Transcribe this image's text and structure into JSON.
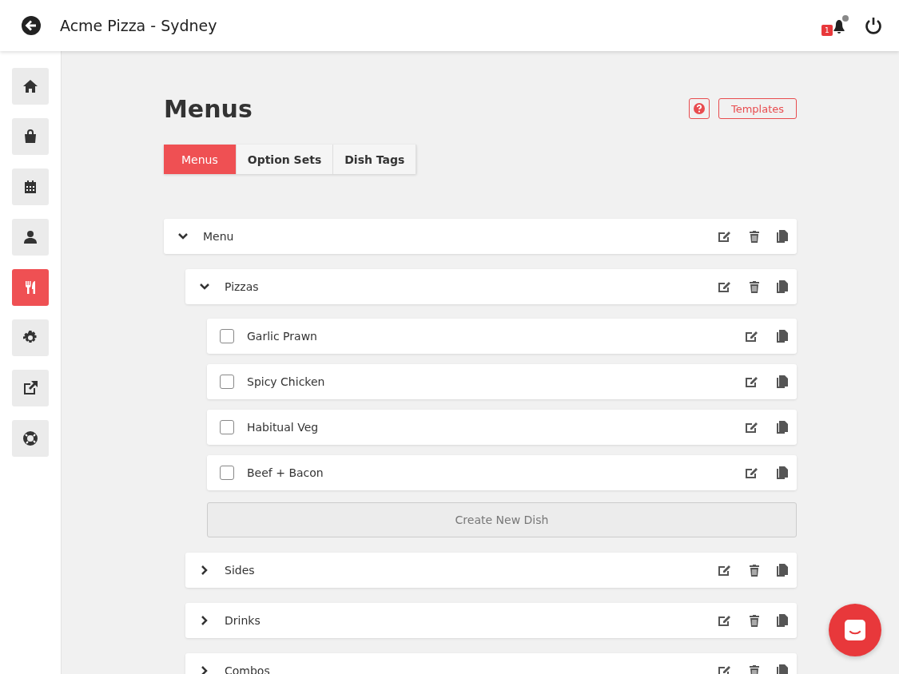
{
  "header": {
    "title": "Acme Pizza - Sydney",
    "notification_count": "1"
  },
  "sidebar": {
    "items": [
      {
        "selected": false
      },
      {
        "selected": false
      },
      {
        "selected": false
      },
      {
        "selected": false
      },
      {
        "selected": true
      },
      {
        "selected": false
      },
      {
        "selected": false
      },
      {
        "selected": false
      }
    ]
  },
  "page": {
    "title": "Menus",
    "templates_button": "Templates"
  },
  "tabs": [
    {
      "label": "Menus",
      "selected": true
    },
    {
      "label": "Option Sets",
      "selected": false
    },
    {
      "label": "Dish Tags",
      "selected": false
    }
  ],
  "menus": [
    {
      "name": "Menu",
      "expanded": true,
      "categories": [
        {
          "name": "Pizzas",
          "expanded": true,
          "create_button": "Create New Dish",
          "dishes": [
            {
              "name": "Garlic Prawn",
              "checked": false
            },
            {
              "name": "Spicy Chicken",
              "checked": false
            },
            {
              "name": "Habitual Veg",
              "checked": false
            },
            {
              "name": "Beef + Bacon",
              "checked": false
            }
          ]
        },
        {
          "name": "Sides",
          "expanded": false
        },
        {
          "name": "Drinks",
          "expanded": false
        },
        {
          "name": "Combos",
          "expanded": false
        }
      ]
    }
  ]
}
